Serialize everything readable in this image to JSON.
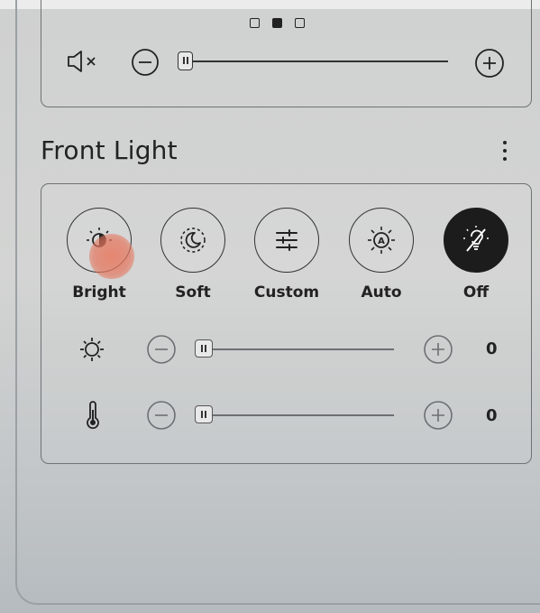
{
  "volume": {
    "pages": [
      {
        "active": false
      },
      {
        "active": true
      },
      {
        "active": false
      }
    ],
    "level": 0
  },
  "front_light": {
    "title": "Front Light",
    "modes": [
      {
        "label": "Bright",
        "icon": "sun-moon-icon",
        "selected": false
      },
      {
        "label": "Soft",
        "icon": "moon-icon",
        "selected": false
      },
      {
        "label": "Custom",
        "icon": "sliders-icon",
        "selected": false
      },
      {
        "label": "Auto",
        "icon": "auto-brightness-icon",
        "selected": false
      },
      {
        "label": "Off",
        "icon": "light-off-icon",
        "selected": true
      }
    ],
    "brightness": {
      "icon": "sun-icon",
      "value": "0"
    },
    "warmth": {
      "icon": "thermometer-icon",
      "value": "0"
    }
  }
}
